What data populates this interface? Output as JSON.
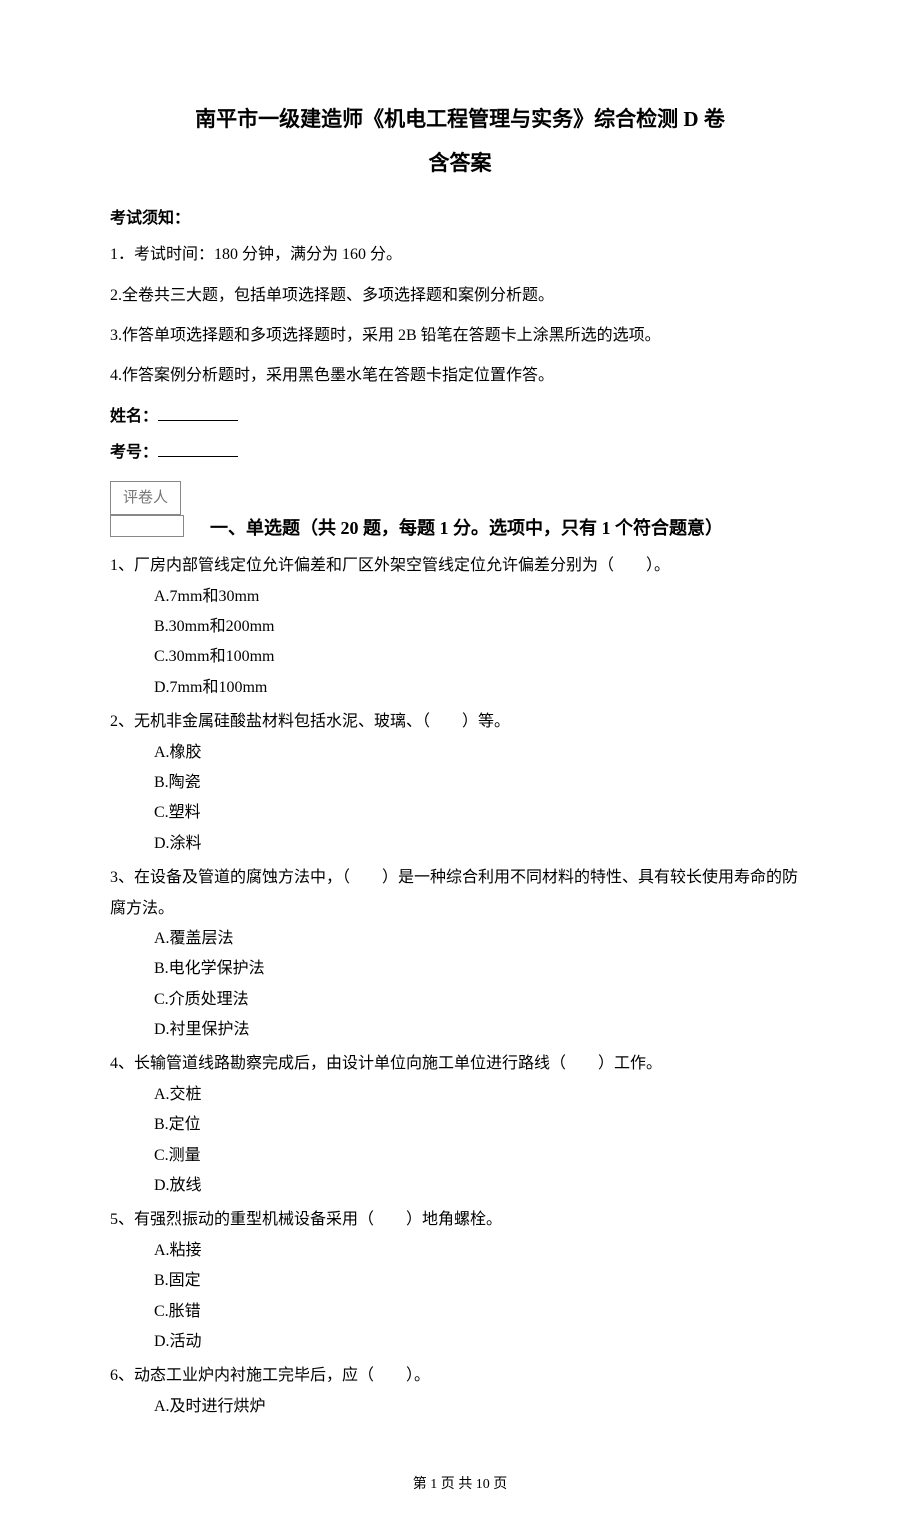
{
  "title": "南平市一级建造师《机电工程管理与实务》综合检测 D 卷",
  "subtitle": "含答案",
  "notice_heading": "考试须知：",
  "notices": [
    "1．考试时间：180 分钟，满分为 160 分。",
    "2.全卷共三大题，包括单项选择题、多项选择题和案例分析题。",
    "3.作答单项选择题和多项选择题时，采用 2B 铅笔在答题卡上涂黑所选的选项。",
    "4.作答案例分析题时，采用黑色墨水笔在答题卡指定位置作答。"
  ],
  "name_label": "姓名：",
  "num_label": "考号：",
  "grader_label": "评卷人",
  "section_heading": "一、单选题（共 20 题，每题 1 分。选项中，只有 1 个符合题意）",
  "questions": [
    {
      "text": "1、厂房内部管线定位允许偏差和厂区外架空管线定位允许偏差分别为（　　）。",
      "options": [
        "A.7mm和30mm",
        "B.30mm和200mm",
        "C.30mm和100mm",
        "D.7mm和100mm"
      ]
    },
    {
      "text": "2、无机非金属硅酸盐材料包括水泥、玻璃、（　　）等。",
      "options": [
        "A.橡胶",
        "B.陶瓷",
        "C.塑料",
        "D.涂料"
      ]
    },
    {
      "text": "3、在设备及管道的腐蚀方法中，（　　）是一种综合利用不同材料的特性、具有较长使用寿命的防腐方法。",
      "options": [
        "A.覆盖层法",
        "B.电化学保护法",
        "C.介质处理法",
        "D.衬里保护法"
      ]
    },
    {
      "text": "4、长输管道线路勘察完成后，由设计单位向施工单位进行路线（　　）工作。",
      "options": [
        "A.交桩",
        "B.定位",
        "C.测量",
        "D.放线"
      ]
    },
    {
      "text": "5、有强烈振动的重型机械设备采用（　　）地角螺栓。",
      "options": [
        "A.粘接",
        "B.固定",
        "C.胀错",
        "D.活动"
      ]
    },
    {
      "text": "6、动态工业炉内衬施工完毕后，应（　　）。",
      "options": [
        "A.及时进行烘炉"
      ]
    }
  ],
  "footer": "第 1 页 共 10 页"
}
